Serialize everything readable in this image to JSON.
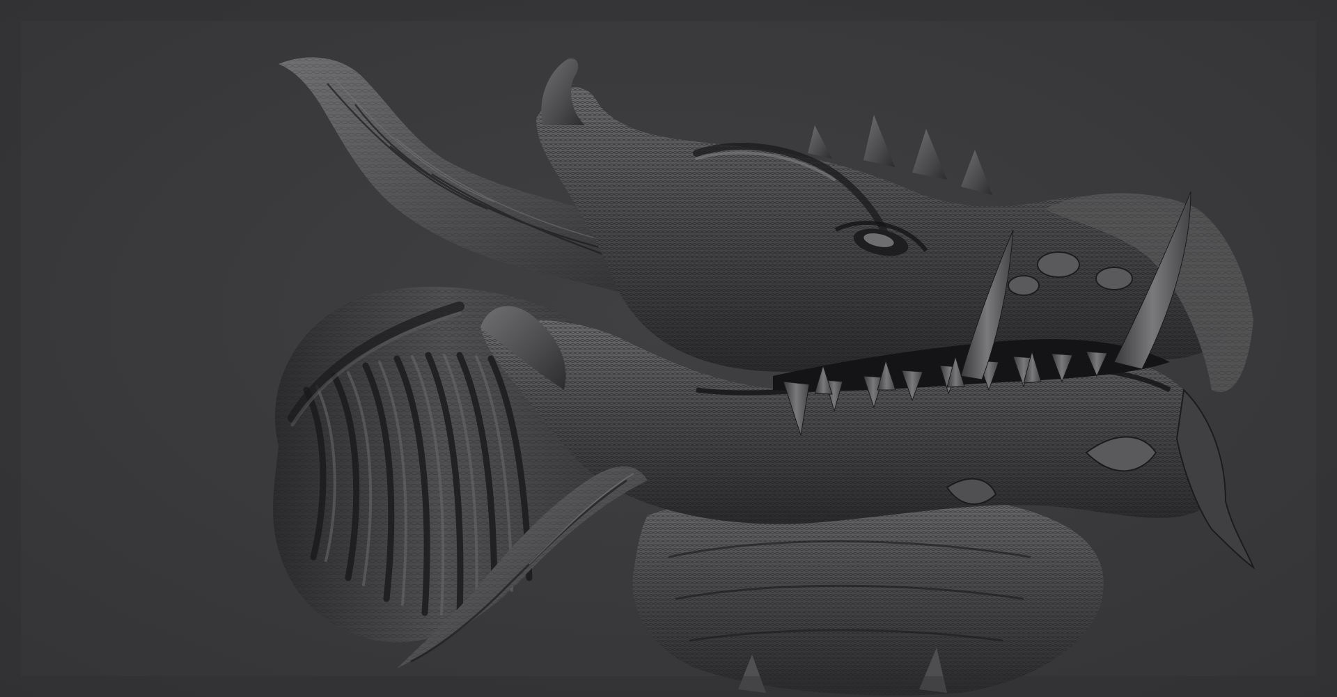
{
  "scene": {
    "subject": "sculpted-dragon-head",
    "colors": {
      "background": "#3b3b3d",
      "background_edge": "#303032",
      "clay_light": "#7a7a7c",
      "clay_mid": "#4b4b4d",
      "clay_dark": "#232325",
      "crevice": "#151517",
      "tooth": "#6d6d6f"
    }
  }
}
